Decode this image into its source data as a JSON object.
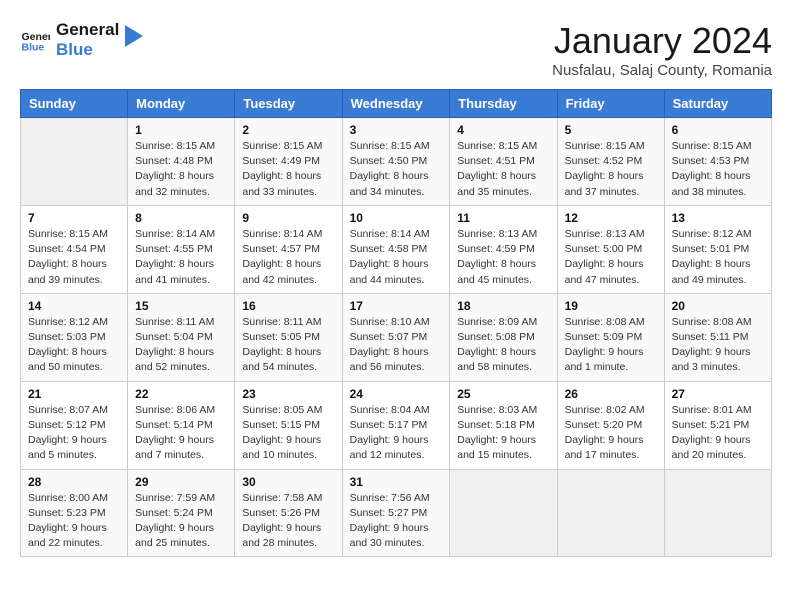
{
  "header": {
    "logo_line1": "General",
    "logo_line2": "Blue",
    "month_title": "January 2024",
    "subtitle": "Nusfalau, Salaj County, Romania"
  },
  "weekdays": [
    "Sunday",
    "Monday",
    "Tuesday",
    "Wednesday",
    "Thursday",
    "Friday",
    "Saturday"
  ],
  "weeks": [
    [
      {
        "day": "",
        "info": ""
      },
      {
        "day": "1",
        "info": "Sunrise: 8:15 AM\nSunset: 4:48 PM\nDaylight: 8 hours\nand 32 minutes."
      },
      {
        "day": "2",
        "info": "Sunrise: 8:15 AM\nSunset: 4:49 PM\nDaylight: 8 hours\nand 33 minutes."
      },
      {
        "day": "3",
        "info": "Sunrise: 8:15 AM\nSunset: 4:50 PM\nDaylight: 8 hours\nand 34 minutes."
      },
      {
        "day": "4",
        "info": "Sunrise: 8:15 AM\nSunset: 4:51 PM\nDaylight: 8 hours\nand 35 minutes."
      },
      {
        "day": "5",
        "info": "Sunrise: 8:15 AM\nSunset: 4:52 PM\nDaylight: 8 hours\nand 37 minutes."
      },
      {
        "day": "6",
        "info": "Sunrise: 8:15 AM\nSunset: 4:53 PM\nDaylight: 8 hours\nand 38 minutes."
      }
    ],
    [
      {
        "day": "7",
        "info": "Sunrise: 8:15 AM\nSunset: 4:54 PM\nDaylight: 8 hours\nand 39 minutes."
      },
      {
        "day": "8",
        "info": "Sunrise: 8:14 AM\nSunset: 4:55 PM\nDaylight: 8 hours\nand 41 minutes."
      },
      {
        "day": "9",
        "info": "Sunrise: 8:14 AM\nSunset: 4:57 PM\nDaylight: 8 hours\nand 42 minutes."
      },
      {
        "day": "10",
        "info": "Sunrise: 8:14 AM\nSunset: 4:58 PM\nDaylight: 8 hours\nand 44 minutes."
      },
      {
        "day": "11",
        "info": "Sunrise: 8:13 AM\nSunset: 4:59 PM\nDaylight: 8 hours\nand 45 minutes."
      },
      {
        "day": "12",
        "info": "Sunrise: 8:13 AM\nSunset: 5:00 PM\nDaylight: 8 hours\nand 47 minutes."
      },
      {
        "day": "13",
        "info": "Sunrise: 8:12 AM\nSunset: 5:01 PM\nDaylight: 8 hours\nand 49 minutes."
      }
    ],
    [
      {
        "day": "14",
        "info": "Sunrise: 8:12 AM\nSunset: 5:03 PM\nDaylight: 8 hours\nand 50 minutes."
      },
      {
        "day": "15",
        "info": "Sunrise: 8:11 AM\nSunset: 5:04 PM\nDaylight: 8 hours\nand 52 minutes."
      },
      {
        "day": "16",
        "info": "Sunrise: 8:11 AM\nSunset: 5:05 PM\nDaylight: 8 hours\nand 54 minutes."
      },
      {
        "day": "17",
        "info": "Sunrise: 8:10 AM\nSunset: 5:07 PM\nDaylight: 8 hours\nand 56 minutes."
      },
      {
        "day": "18",
        "info": "Sunrise: 8:09 AM\nSunset: 5:08 PM\nDaylight: 8 hours\nand 58 minutes."
      },
      {
        "day": "19",
        "info": "Sunrise: 8:08 AM\nSunset: 5:09 PM\nDaylight: 9 hours\nand 1 minute."
      },
      {
        "day": "20",
        "info": "Sunrise: 8:08 AM\nSunset: 5:11 PM\nDaylight: 9 hours\nand 3 minutes."
      }
    ],
    [
      {
        "day": "21",
        "info": "Sunrise: 8:07 AM\nSunset: 5:12 PM\nDaylight: 9 hours\nand 5 minutes."
      },
      {
        "day": "22",
        "info": "Sunrise: 8:06 AM\nSunset: 5:14 PM\nDaylight: 9 hours\nand 7 minutes."
      },
      {
        "day": "23",
        "info": "Sunrise: 8:05 AM\nSunset: 5:15 PM\nDaylight: 9 hours\nand 10 minutes."
      },
      {
        "day": "24",
        "info": "Sunrise: 8:04 AM\nSunset: 5:17 PM\nDaylight: 9 hours\nand 12 minutes."
      },
      {
        "day": "25",
        "info": "Sunrise: 8:03 AM\nSunset: 5:18 PM\nDaylight: 9 hours\nand 15 minutes."
      },
      {
        "day": "26",
        "info": "Sunrise: 8:02 AM\nSunset: 5:20 PM\nDaylight: 9 hours\nand 17 minutes."
      },
      {
        "day": "27",
        "info": "Sunrise: 8:01 AM\nSunset: 5:21 PM\nDaylight: 9 hours\nand 20 minutes."
      }
    ],
    [
      {
        "day": "28",
        "info": "Sunrise: 8:00 AM\nSunset: 5:23 PM\nDaylight: 9 hours\nand 22 minutes."
      },
      {
        "day": "29",
        "info": "Sunrise: 7:59 AM\nSunset: 5:24 PM\nDaylight: 9 hours\nand 25 minutes."
      },
      {
        "day": "30",
        "info": "Sunrise: 7:58 AM\nSunset: 5:26 PM\nDaylight: 9 hours\nand 28 minutes."
      },
      {
        "day": "31",
        "info": "Sunrise: 7:56 AM\nSunset: 5:27 PM\nDaylight: 9 hours\nand 30 minutes."
      },
      {
        "day": "",
        "info": ""
      },
      {
        "day": "",
        "info": ""
      },
      {
        "day": "",
        "info": ""
      }
    ]
  ]
}
